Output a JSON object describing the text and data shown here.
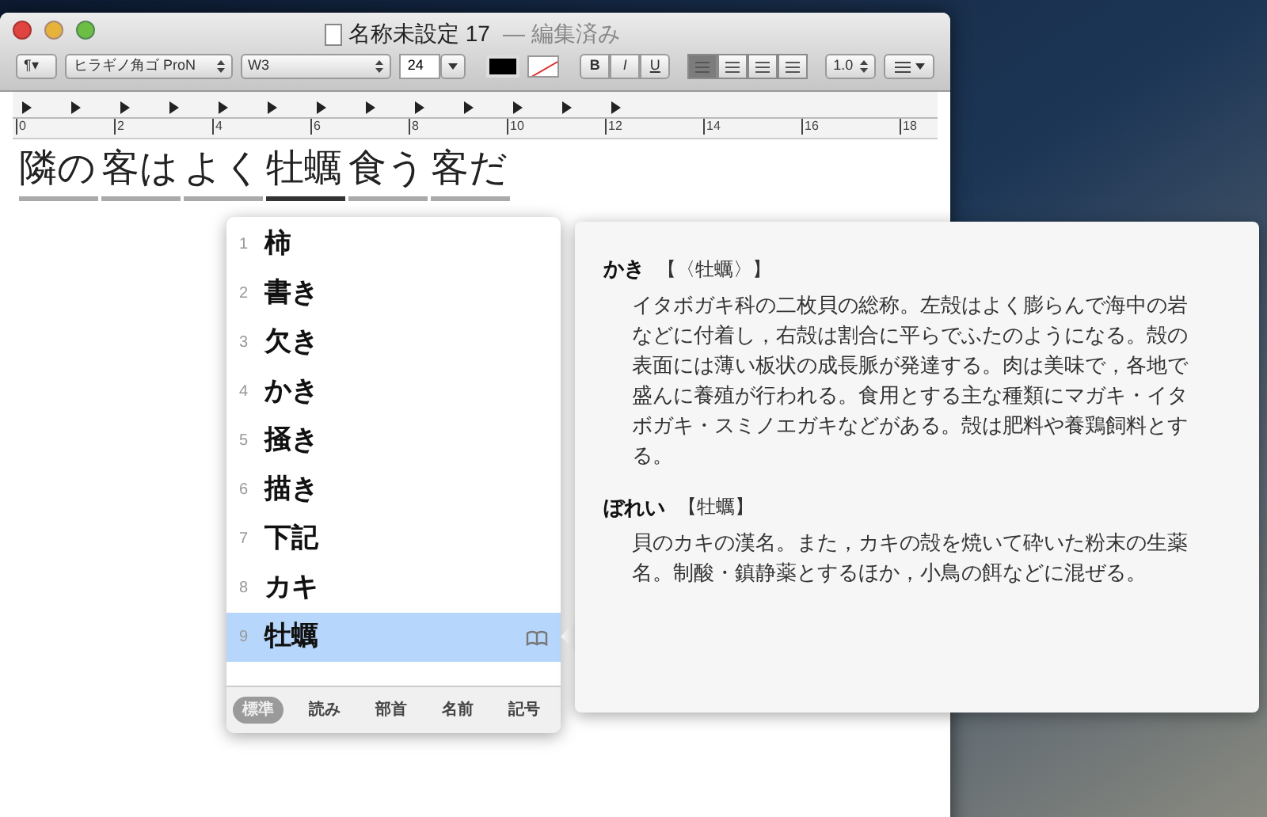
{
  "window": {
    "title": "名称未設定 17",
    "status": "— 編集済み"
  },
  "toolbar": {
    "paragraph": "¶▾",
    "font": "ヒラギノ角ゴ ProN",
    "weight": "W3",
    "size": "24",
    "bold": "B",
    "italic": "I",
    "underline": "U",
    "alignments": [
      {
        "selected": true
      },
      {
        "selected": false
      },
      {
        "selected": false
      },
      {
        "selected": false
      }
    ],
    "spacing": "1.0"
  },
  "ruler": {
    "labels": [
      "0",
      "2",
      "4",
      "6",
      "8",
      "10",
      "12",
      "14",
      "16",
      "18"
    ]
  },
  "document": {
    "segments": [
      {
        "text": "隣の",
        "selected": false
      },
      {
        "text": "客は",
        "selected": false
      },
      {
        "text": "よく",
        "selected": false
      },
      {
        "text": "牡蠣",
        "selected": true
      },
      {
        "text": "食う",
        "selected": false
      },
      {
        "text": "客だ",
        "selected": false
      }
    ]
  },
  "candidates": {
    "items": [
      {
        "number": "1",
        "text": "柿",
        "selected": false
      },
      {
        "number": "2",
        "text": "書き",
        "selected": false
      },
      {
        "number": "3",
        "text": "欠き",
        "selected": false
      },
      {
        "number": "4",
        "text": "かき",
        "selected": false
      },
      {
        "number": "5",
        "text": "掻き",
        "selected": false
      },
      {
        "number": "6",
        "text": "描き",
        "selected": false
      },
      {
        "number": "7",
        "text": "下記",
        "selected": false
      },
      {
        "number": "8",
        "text": "カキ",
        "selected": false
      },
      {
        "number": "9",
        "text": "牡蠣",
        "selected": true
      }
    ],
    "tabs": [
      {
        "label": "標準",
        "selected": true
      },
      {
        "label": "読み",
        "selected": false
      },
      {
        "label": "部首",
        "selected": false
      },
      {
        "label": "名前",
        "selected": false
      },
      {
        "label": "記号",
        "selected": false
      }
    ]
  },
  "dictionary": {
    "entries": [
      {
        "headword": "かき",
        "notation": "【〈牡蠣〉】",
        "body": "イタボガキ科の二枚貝の総称。左殻はよく膨らんで海中の岩などに付着し，右殻は割合に平らでふたのようになる。殻の表面には薄い板状の成長脈が発達する。肉は美味で，各地で盛んに養殖が行われる。食用とする主な種類にマガキ・イタボガキ・スミノエガキなどがある。殻は肥料や養鶏飼料とする。"
      },
      {
        "headword": "ぼれい",
        "notation": "【牡蠣】",
        "body": "貝のカキの漢名。また，カキの殻を焼いて砕いた粉末の生薬名。制酸・鎮静薬とするほか，小鳥の餌などに混ぜる。"
      }
    ]
  }
}
